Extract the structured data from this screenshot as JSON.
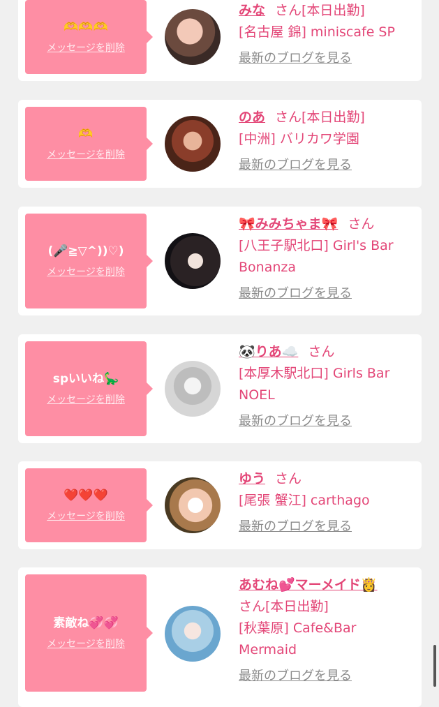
{
  "delete_label": "メッセージを削除",
  "blog_label": "最新のブログを見る",
  "san_label": "さん",
  "colors": {
    "bubble": "#fe8ea4",
    "name": "#e34677",
    "page_bg": "#f0f0f0",
    "link_gray": "#8a8a8a"
  },
  "cards": [
    {
      "message": "🫶🫶🫶",
      "name": "みな",
      "suffix": "さん[本日出勤]",
      "shop": "[名古屋 錦] miniscafe SP"
    },
    {
      "message": "🫶",
      "name": "のあ",
      "suffix": "さん[本日出勤]",
      "shop": "[中洲] バリカワ学園"
    },
    {
      "message": "(🎤≧▽^))♡)",
      "name": "🎀みみちゃま🎀",
      "suffix": "さん",
      "shop": "[八王子駅北口] Girl's Bar Bonanza"
    },
    {
      "message": "spいいね🦕",
      "name": "🐼りあ☁️",
      "suffix": "さん",
      "shop": "[本厚木駅北口] Girls Bar NOEL"
    },
    {
      "message": "❤️❤️❤️",
      "name": "ゆう",
      "suffix": "さん",
      "shop": "[尾張 蟹江] carthago"
    },
    {
      "message": "素敵ね💞💞",
      "name": "あむね💕マーメイド👸",
      "suffix": "さん[本日出勤]",
      "shop": "[秋葉原] Cafe&Bar Mermaid"
    }
  ]
}
